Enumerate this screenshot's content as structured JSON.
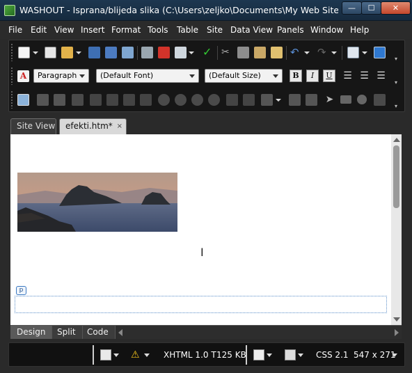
{
  "window": {
    "title": "WASHOUT - Isprana/blijeda slika (C:\\Users\\zeljko\\Documents\\My Web Sites\\efekti.h...",
    "controls": {
      "minimize": "—",
      "maximize": "☐",
      "close": "✕"
    }
  },
  "menu": [
    "File",
    "Edit",
    "View",
    "Insert",
    "Format",
    "Tools",
    "Table",
    "Site",
    "Data View",
    "Panels",
    "Window",
    "Help"
  ],
  "toolbar": {
    "row1_icons": [
      "new-page-icon",
      "open-icon",
      "folder-icon",
      "save-icon",
      "save-all-icon",
      "find-icon",
      "publish-icon",
      "spelling-icon",
      "preview-icon",
      "check-spelling-icon",
      "cut-icon",
      "copy-icon",
      "paste-icon",
      "format-painter-icon",
      "undo-icon",
      "redo-icon",
      "table-icon",
      "layers-icon"
    ],
    "style_combo": "Paragraph",
    "font_combo": "(Default Font)",
    "size_combo": "(Default Size)",
    "bold": "B",
    "italic": "I",
    "underline": "U"
  },
  "tabs": [
    {
      "label": "Site View",
      "active": false
    },
    {
      "label": "efekti.htm*",
      "active": true,
      "close": "×"
    }
  ],
  "canvas": {
    "image_alt": "seascape with islands at dusk",
    "tag_label": "p"
  },
  "view_modes": [
    {
      "label": "Design",
      "active": true
    },
    {
      "label": "Split",
      "active": false
    },
    {
      "label": "Code",
      "active": false
    }
  ],
  "status": {
    "doctype": "XHTML 1.0 T",
    "page_size": "125 KB",
    "css_version": "CSS 2.1",
    "dimensions": "547 x 271"
  },
  "colors": {
    "titlebar": "#1d3750",
    "chrome": "#2b2b2b",
    "accent_blue": "#3a78c2"
  }
}
